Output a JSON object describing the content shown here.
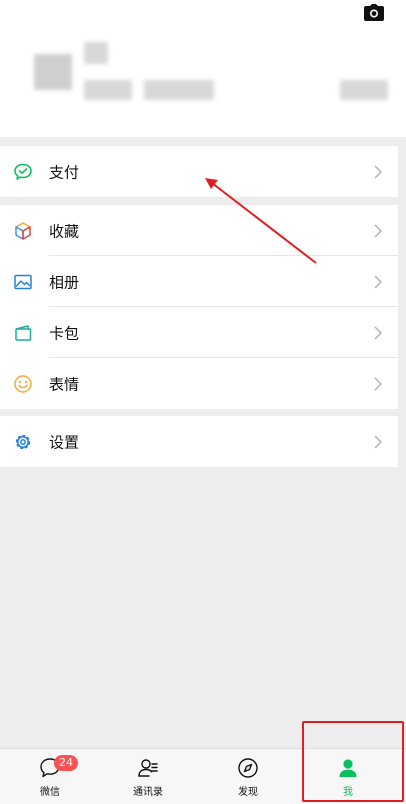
{
  "menu": {
    "pay": "支付",
    "favorites": "收藏",
    "album": "相册",
    "cards": "卡包",
    "stickers": "表情",
    "settings": "设置"
  },
  "tabs": [
    {
      "label": "微信",
      "icon": "chat-icon",
      "badge": "24"
    },
    {
      "label": "通讯录",
      "icon": "contacts-icon"
    },
    {
      "label": "发现",
      "icon": "compass-icon"
    },
    {
      "label": "我",
      "icon": "person-icon",
      "active": true
    }
  ],
  "colors": {
    "accent": "#07c160",
    "badge": "#fa5151",
    "annotation": "#e02020",
    "background": "#ededed"
  }
}
